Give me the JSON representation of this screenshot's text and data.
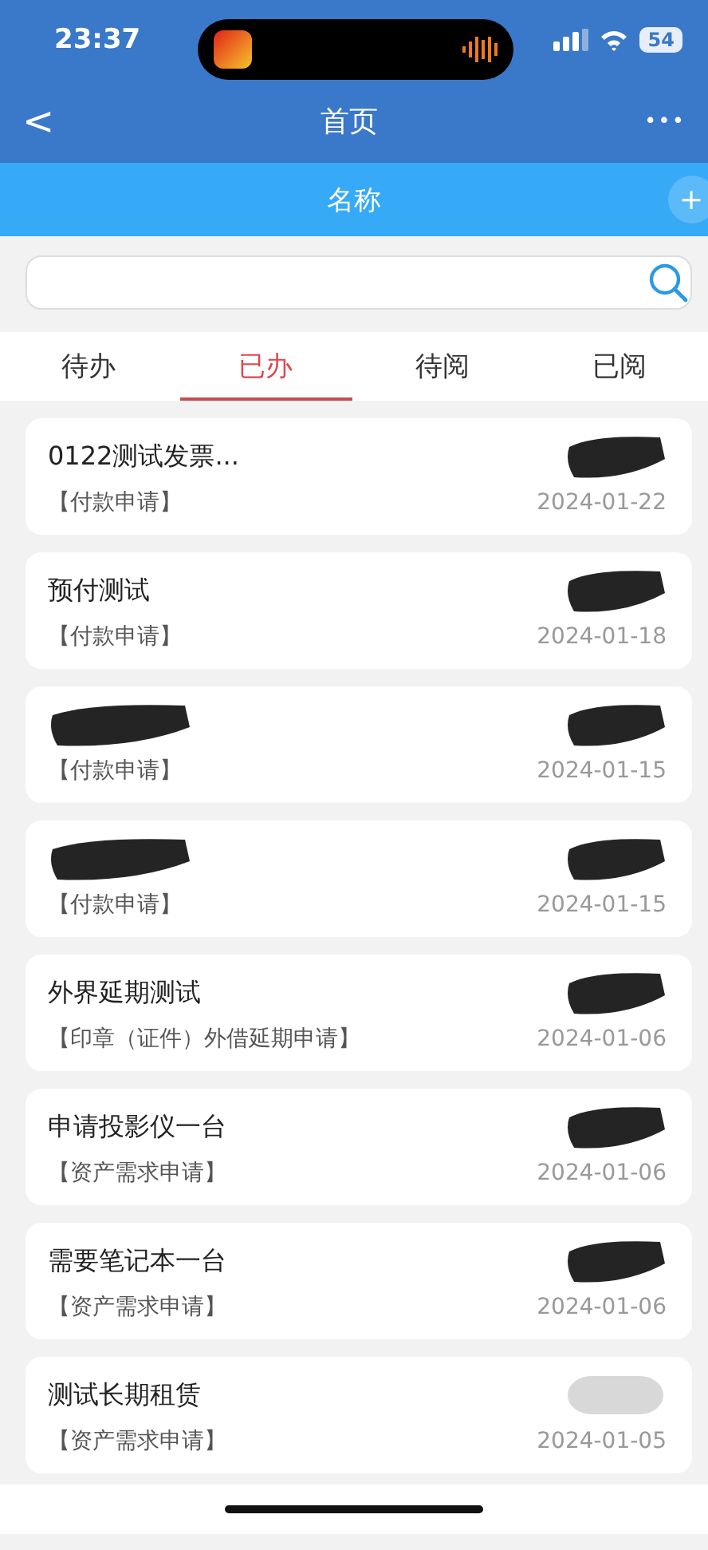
{
  "status_bar": {
    "time": "23:37",
    "battery": "54"
  },
  "nav_bar": {
    "back": "<",
    "title": "首页",
    "more": "•••"
  },
  "header": {
    "title": "名称",
    "add": "+"
  },
  "tabs": [
    {
      "label": "待办",
      "selected": false
    },
    {
      "label": "已办",
      "selected": true
    },
    {
      "label": "待阅",
      "selected": false
    },
    {
      "label": "已阅",
      "selected": false
    }
  ],
  "items": [
    {
      "title": "0122测试发票...",
      "title_redacted": false,
      "category": "【付款申请】",
      "date": "2024-01-22",
      "sender_blurred": false
    },
    {
      "title": "预付测试",
      "title_redacted": false,
      "category": "【付款申请】",
      "date": "2024-01-18",
      "sender_blurred": false
    },
    {
      "title_redacted": true,
      "category": "【付款申请】",
      "date": "2024-01-15",
      "sender_blurred": false
    },
    {
      "title_redacted": true,
      "category": "【付款申请】",
      "date": "2024-01-15",
      "sender_blurred": false
    },
    {
      "title": "外界延期测试",
      "title_redacted": false,
      "category": "【印章（证件）外借延期申请】",
      "date": "2024-01-06",
      "sender_blurred": false
    },
    {
      "title": "申请投影仪一台",
      "title_redacted": false,
      "category": "【资产需求申请】",
      "date": "2024-01-06",
      "sender_blurred": false
    },
    {
      "title": "需要笔记本一台",
      "title_redacted": false,
      "category": "【资产需求申请】",
      "date": "2024-01-06",
      "sender_blurred": false
    },
    {
      "title": "测试长期租赁",
      "title_redacted": false,
      "category": "【资产需求申请】",
      "date": "2024-01-05",
      "sender_blurred": true
    }
  ]
}
